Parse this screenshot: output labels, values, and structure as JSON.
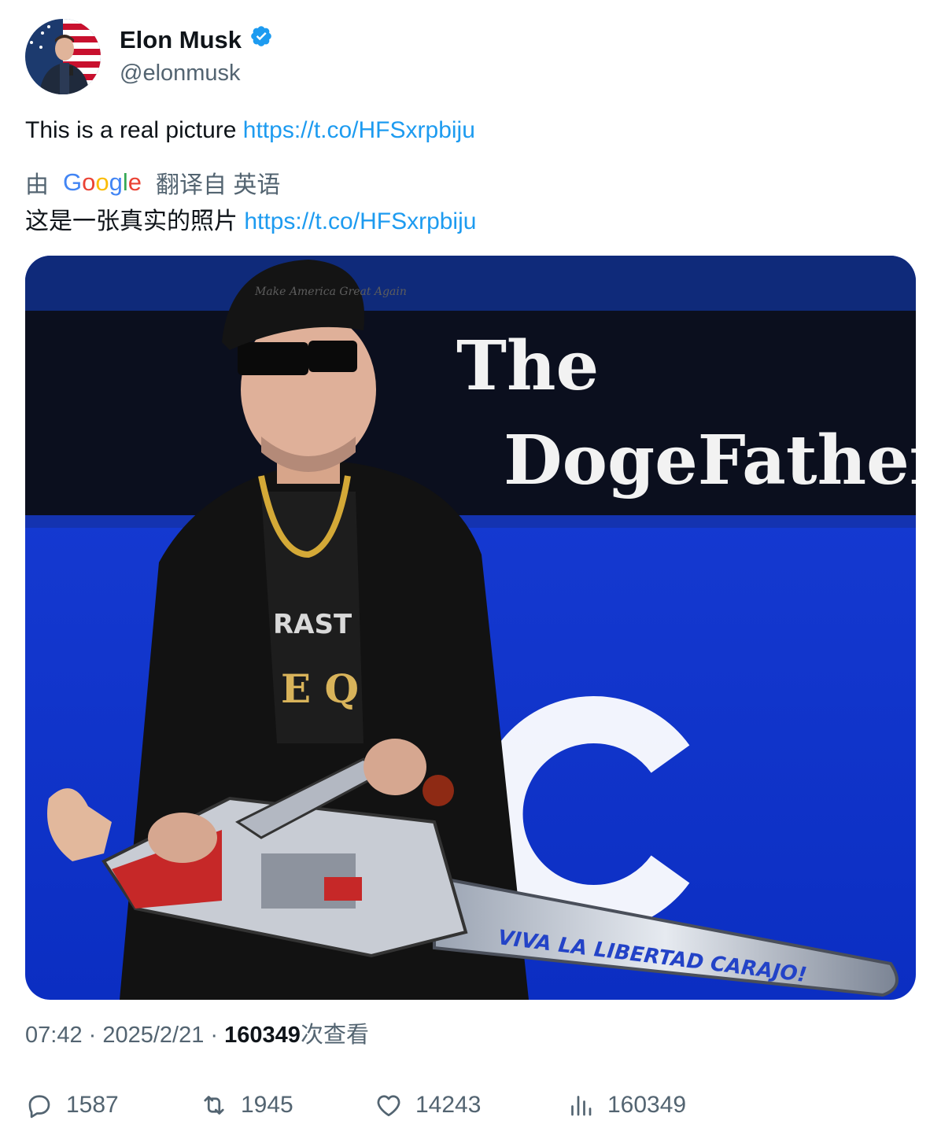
{
  "author": {
    "display_name": "Elon Musk",
    "handle": "@elonmusk",
    "verified": true,
    "verified_color": "#1d9bf0"
  },
  "tweet": {
    "text": "This is a real picture ",
    "link": "https://t.co/HFSxrpbiju"
  },
  "translation": {
    "prefix": "由",
    "provider_logo": "Google",
    "suffix": "翻译自 英语",
    "text": "这是一张真实的照片 ",
    "link": "https://t.co/HFSxrpbiju"
  },
  "media": {
    "poster_line1": "The",
    "poster_line2": "DogeFather",
    "cap_text": "Make America Great Again",
    "chainsaw_text": "VIVA LA LIBERTAD CARAJO!"
  },
  "meta": {
    "time": "07:42",
    "sep1": " · ",
    "date": "2025/2/21",
    "sep2": " · ",
    "views": "160349",
    "views_label": "次查看"
  },
  "actions": {
    "replies": "1587",
    "retweets": "1945",
    "likes": "14243",
    "views": "160349"
  },
  "colors": {
    "link": "#1d9bf0",
    "secondary_text": "#536471",
    "stage_blue": "#1740e0"
  }
}
